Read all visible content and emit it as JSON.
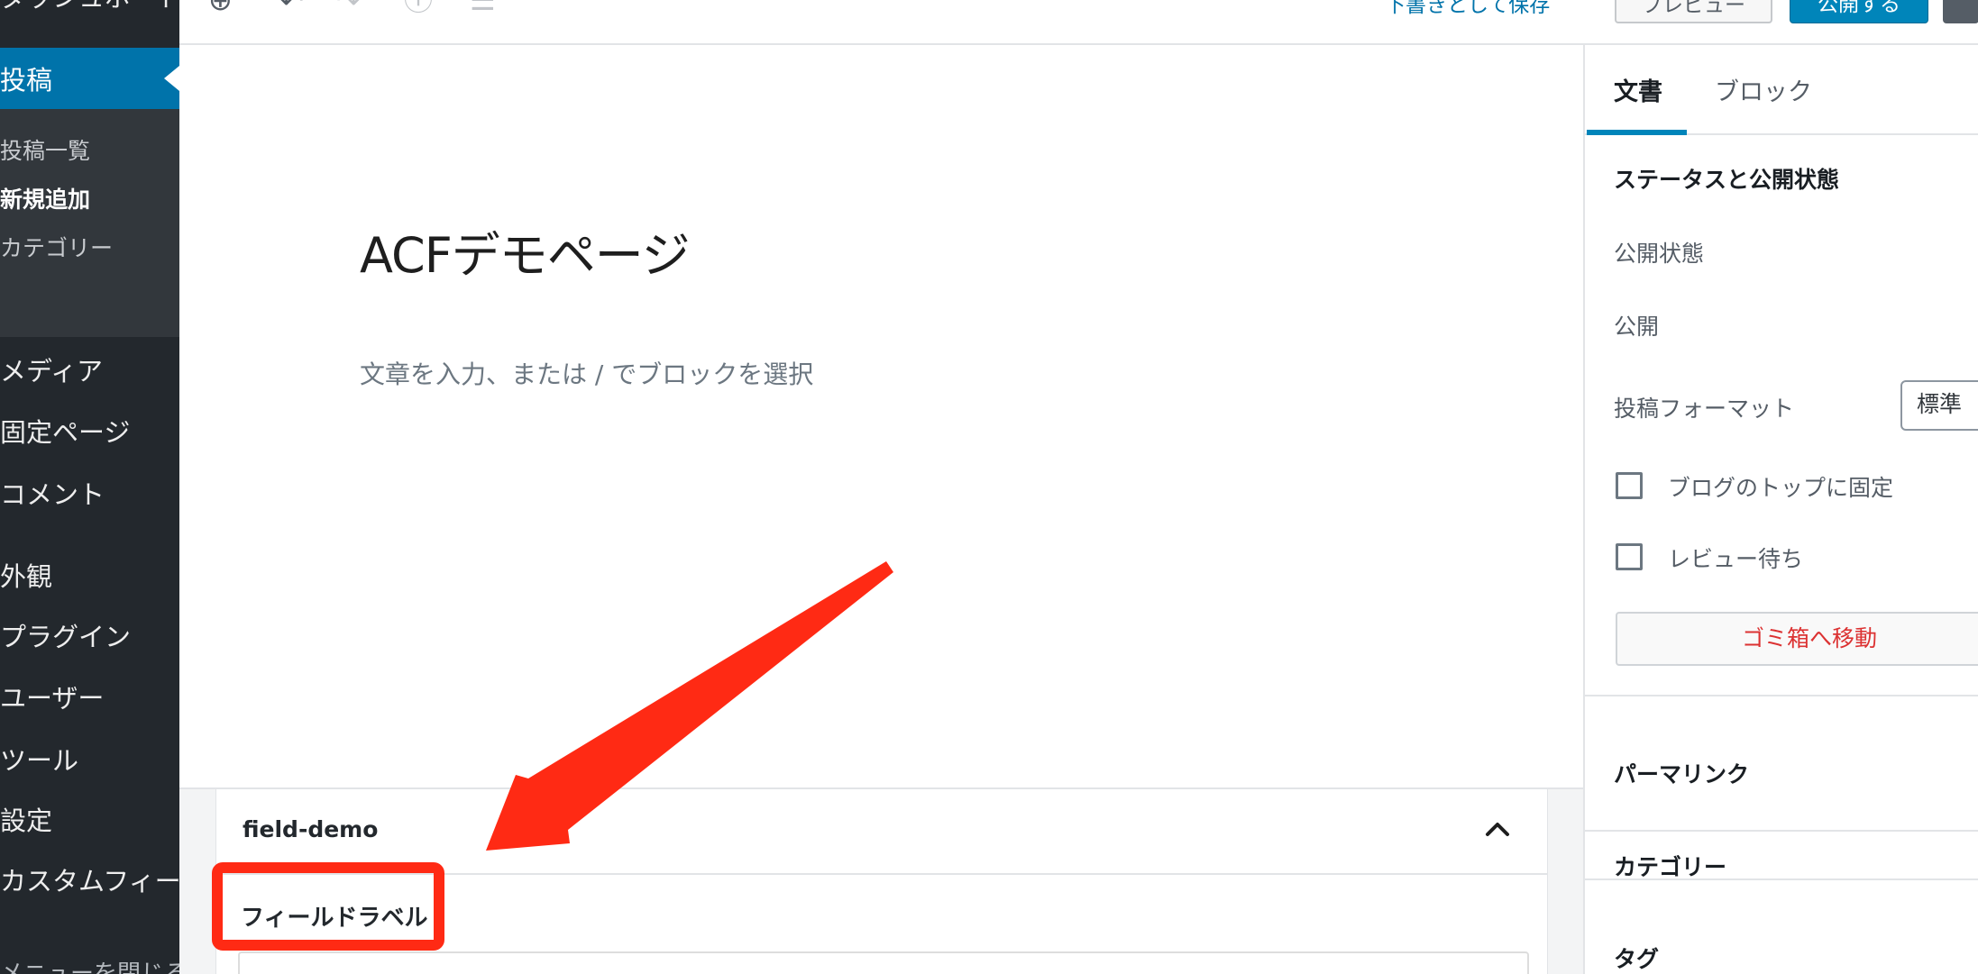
{
  "sidebar": {
    "dashboard": "ダッシュボード",
    "posts": "投稿",
    "sub_all": "投稿一覧",
    "sub_new": "新規追加",
    "sub_category": "カテゴリー",
    "media": "メディア",
    "pages": "固定ページ",
    "comments": "コメント",
    "appearance": "外観",
    "plugins": "プラグイン",
    "users": "ユーザー",
    "tools": "ツール",
    "settings": "設定",
    "custom_fields": "カスタムフィールド",
    "collapse": "メニューを閉じる"
  },
  "toolbar": {
    "save_draft": "下書きとして保存",
    "preview": "プレビュー",
    "publish": "公開する"
  },
  "editor": {
    "title": "ACFデモページ",
    "placeholder": "文章を入力、または / でブロックを選択"
  },
  "metabox": {
    "title": "field-demo",
    "field_label": "フィールドラベル"
  },
  "settings": {
    "tab_document": "文書",
    "tab_block": "ブロック",
    "status_heading": "ステータスと公開状態",
    "visibility_label": "公開状態",
    "publish_label": "公開",
    "format_label": "投稿フォーマット",
    "format_value": "標準",
    "sticky_label": "ブログのトップに固定",
    "pending_label": "レビュー待ち",
    "trash_button": "ゴミ箱へ移動",
    "permalink_heading": "パーマリンク",
    "category_heading": "カテゴリー",
    "tags_heading": "タグ"
  },
  "colors": {
    "admin_bar": "#23282d",
    "accent": "#0073aa",
    "annotation": "#ff2a14"
  }
}
